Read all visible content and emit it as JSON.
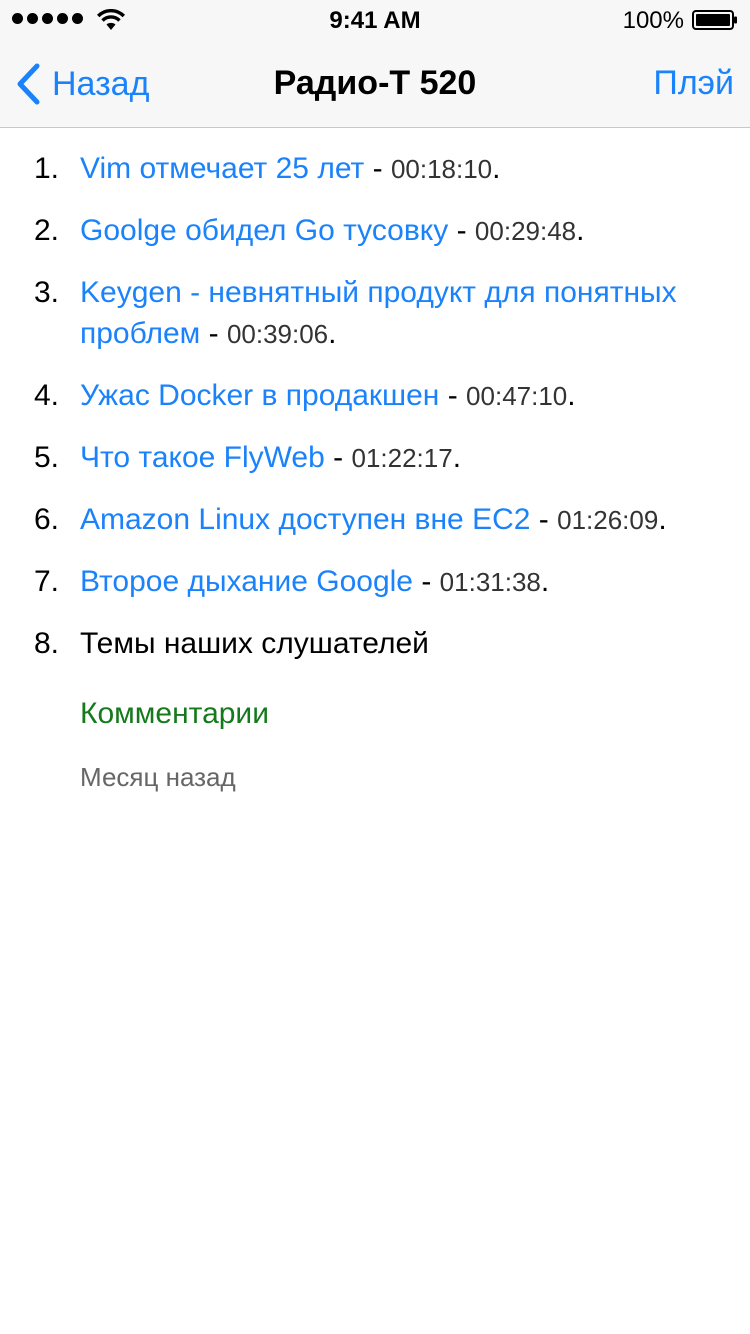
{
  "status_bar": {
    "time": "9:41 AM",
    "battery": "100%"
  },
  "nav": {
    "back_label": "Назад",
    "title": "Радио-Т 520",
    "play_label": "Плэй"
  },
  "topics": [
    {
      "number": "1.",
      "title": "Vim отмечает 25 лет",
      "separator": " - ",
      "time": "00:18:10",
      "end": "."
    },
    {
      "number": "2.",
      "title": "Goolge обидел Go тусовку",
      "separator": " - ",
      "time": "00:29:48",
      "end": "."
    },
    {
      "number": "3.",
      "title": "Keygen - невнятный продукт для понятных проблем",
      "separator": " - ",
      "time": "00:39:06",
      "end": "."
    },
    {
      "number": "4.",
      "title": "Ужас Docker в продакшен",
      "separator": " - ",
      "time": "00:47:10",
      "end": "."
    },
    {
      "number": "5.",
      "title": "Что такое FlyWeb",
      "separator": " - ",
      "time": "01:22:17",
      "end": "."
    },
    {
      "number": "6.",
      "title": "Amazon Linux доступен вне EC2",
      "separator": " - ",
      "time": "01:26:09",
      "end": "."
    },
    {
      "number": "7.",
      "title": "Второе дыхание Google",
      "separator": " - ",
      "time": "01:31:38",
      "end": "."
    },
    {
      "number": "8.",
      "title": "Темы наших слушателей"
    }
  ],
  "comments_label": "Комментарии",
  "age_label": "Месяц назад",
  "colors": {
    "link": "#1a82fb",
    "comments": "#157a1c",
    "nav_background": "#f7f7f7"
  },
  "icons": {
    "signal": "signal-dots-icon",
    "wifi": "wifi-icon",
    "battery": "battery-icon",
    "back": "chevron-left-icon"
  }
}
